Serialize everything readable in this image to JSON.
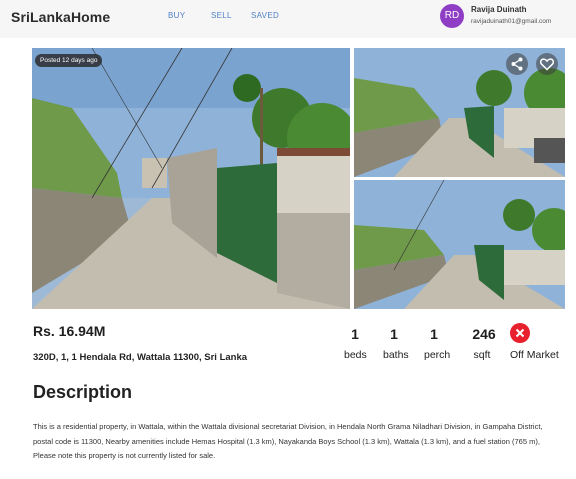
{
  "header": {
    "brand": "SriLankaHome",
    "nav": {
      "buy": "BUY",
      "sell": "SELL",
      "saved": "SAVED"
    },
    "user": {
      "initials": "RD",
      "name": "Ravija Duinath",
      "email": "ravijaduinath01@gmail.com"
    }
  },
  "gallery": {
    "posted_badge": "Posted 12 days ago",
    "icons": {
      "share": "share-icon",
      "favorite": "heart-icon"
    }
  },
  "listing": {
    "price": "Rs. 16.94M",
    "address": "320D, 1, 1 Hendala Rd, Wattala 11300, Sri Lanka",
    "stats": {
      "beds": {
        "value": "1",
        "label": "beds"
      },
      "baths": {
        "value": "1",
        "label": "baths"
      },
      "perch": {
        "value": "1",
        "label": "perch"
      },
      "sqft": {
        "value": "246",
        "label": "sqft"
      }
    },
    "status": {
      "label": "Off Market",
      "color": "#e8202d"
    }
  },
  "description": {
    "title": "Description",
    "text": "This is a residential property, in Wattala, within the Wattala divisional secretariat Division, in Hendala North Grama Niladhari Division, in Gampaha District, postal code is 11300, Nearby amenities include Hemas Hospital (1.3 km), Nayakanda Boys School (1.3 km), Wattala (1.3 km), and a fuel station (765 m), Please note this property is not currently listed for sale."
  },
  "colors": {
    "accent": "#4f80c2",
    "avatar": "#8e3dc4",
    "status_off": "#e8202d"
  }
}
